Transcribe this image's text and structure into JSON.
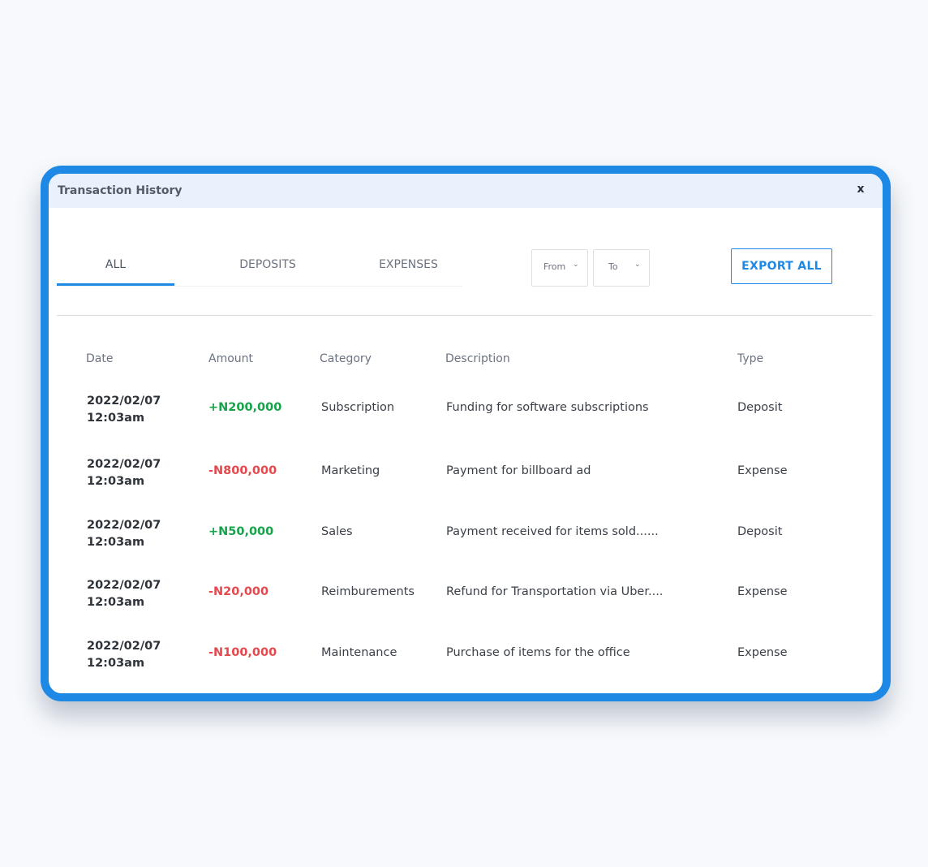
{
  "window": {
    "title": "Transaction History",
    "close_label": "x"
  },
  "tabs": [
    {
      "label": "ALL",
      "active": true
    },
    {
      "label": "DEPOSITS",
      "active": false
    },
    {
      "label": "EXPENSES",
      "active": false
    }
  ],
  "filters": {
    "from_label": "From",
    "to_label": "To",
    "chevron_icon": "chevron-down-icon"
  },
  "export_label": "EXPORT ALL",
  "table": {
    "headers": [
      "Date",
      "Amount",
      "Category",
      "Description",
      "Type"
    ],
    "rows": [
      {
        "date": "2022/02/07",
        "time": "12:03am",
        "amount": "+N200,000",
        "direction": "positive",
        "category": "Subscription",
        "description": "Funding for software subscriptions",
        "type": "Deposit"
      },
      {
        "date": "2022/02/07",
        "time": "12:03am",
        "amount": "-N800,000",
        "direction": "negative",
        "category": "Marketing",
        "description": "Payment for billboard ad",
        "type": "Expense"
      },
      {
        "date": "2022/02/07",
        "time": "12:03am",
        "amount": "+N50,000",
        "direction": "positive",
        "category": "Sales",
        "description": "Payment received for items sold......",
        "type": "Deposit"
      },
      {
        "date": "2022/02/07",
        "time": "12:03am",
        "amount": "-N20,000",
        "direction": "negative",
        "category": "Reimburements",
        "description": "Refund for Transportation via Uber....",
        "type": "Expense"
      },
      {
        "date": "2022/02/07",
        "time": "12:03am",
        "amount": "-N100,000",
        "direction": "negative",
        "category": "Maintenance",
        "description": "Purchase of items for the office",
        "type": "Expense"
      }
    ]
  },
  "colors": {
    "accent": "#1e88e5",
    "positive": "#16a34a",
    "negative": "#e5484d",
    "titlebar": "#e8f1fc"
  }
}
